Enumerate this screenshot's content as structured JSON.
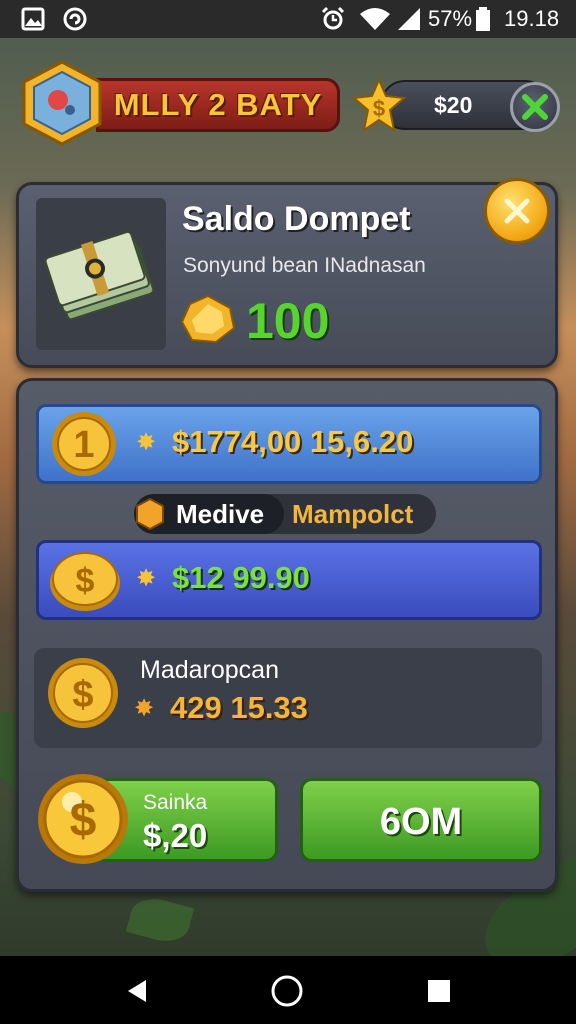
{
  "status_bar": {
    "battery": "57%",
    "time": "19.18",
    "icons": [
      "gallery-icon",
      "sync-icon",
      "alarm-icon",
      "wifi-icon",
      "signal-icon",
      "battery-icon"
    ]
  },
  "header": {
    "title": "MLLY 2   BATY",
    "coin_balance": "$20"
  },
  "wallet": {
    "title": "Saldo Dompet",
    "subtitle": "Sonyund bean INadnasan",
    "amount": "100"
  },
  "offers": [
    {
      "coin_label": "1",
      "amount": "$1774,00 15,6.20"
    },
    {
      "amount": "$12 99.90"
    }
  ],
  "tabs": {
    "active": "Medive",
    "inactive": "Mampolct"
  },
  "detail": {
    "label": "Madaropcan",
    "amount": "429 15.33"
  },
  "buttons": {
    "left_label": "Sainka",
    "left_amount": "$,20",
    "right_label": "6OM"
  },
  "colors": {
    "accent_green": "#58d431",
    "accent_gold": "#f6c84a",
    "panel": "#4f5461",
    "title_red": "#b8352b"
  }
}
